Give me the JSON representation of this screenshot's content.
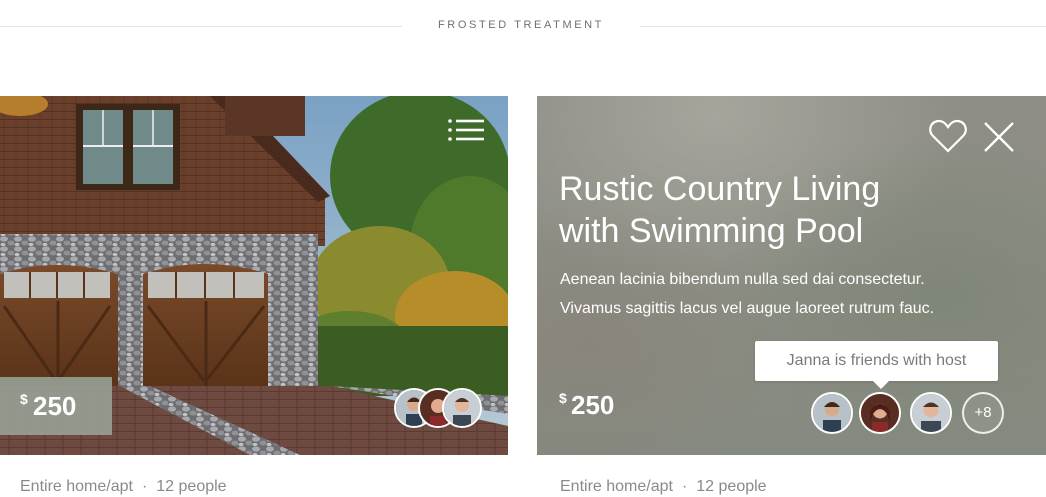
{
  "section_title": "FROSTED TREATMENT",
  "cards": [
    {
      "price_symbol": "$",
      "price": "250",
      "meta_type": "Entire home/apt",
      "meta_separator": "·",
      "meta_people": "12 people"
    },
    {
      "title_line1": "Rustic Country Living",
      "title_line2": "with Swimming Pool",
      "desc_line1": "Aenean lacinia bibendum nulla sed dai consectetur.",
      "desc_line2": "Vivamus sagittis lacus vel augue laoreet rutrum fauc.",
      "tooltip": "Janna is friends with host",
      "price_symbol": "$",
      "price": "250",
      "more_friends": "+8",
      "meta_type": "Entire home/apt",
      "meta_separator": "·",
      "meta_people": "12 people"
    }
  ],
  "colors": {
    "price_badge": "#969e94",
    "frost_bg": "#8d8e85",
    "meta_text": "#8a8a8a"
  },
  "icons": [
    "menu-icon",
    "heart-icon",
    "close-icon"
  ]
}
